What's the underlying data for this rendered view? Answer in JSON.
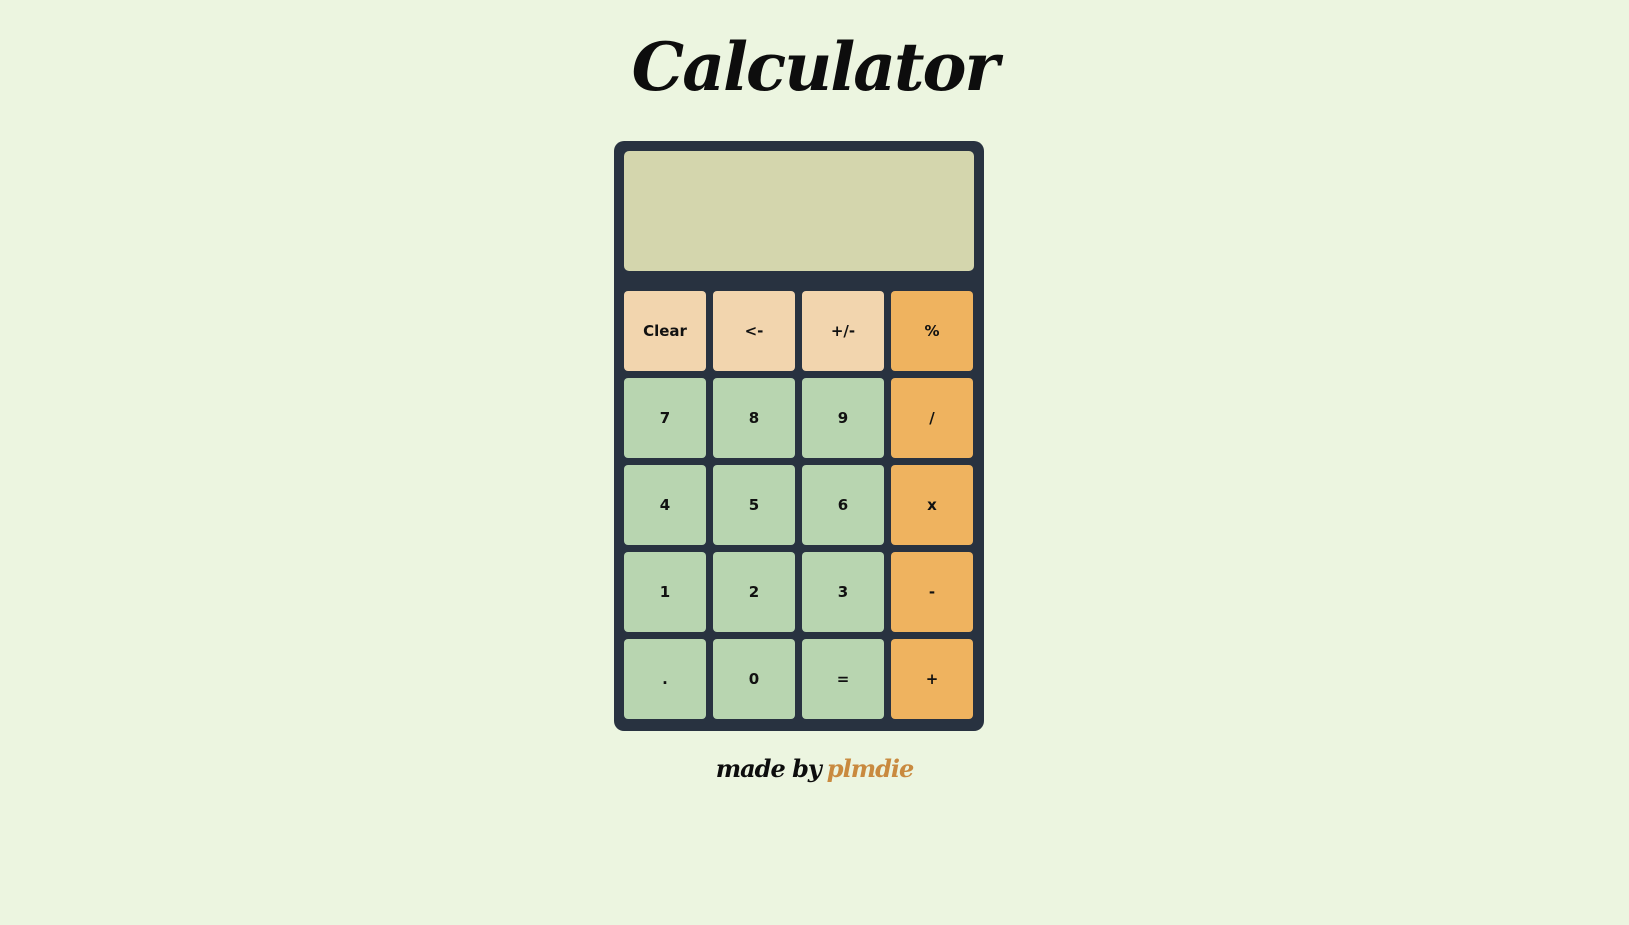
{
  "title": "Calculator",
  "display": {
    "value": ""
  },
  "keys": [
    {
      "label": "Clear",
      "kind": "func",
      "name": "clear-button"
    },
    {
      "label": "<-",
      "kind": "func",
      "name": "backspace-button"
    },
    {
      "label": "+/-",
      "kind": "func",
      "name": "sign-toggle-button"
    },
    {
      "label": "%",
      "kind": "op",
      "name": "percent-button"
    },
    {
      "label": "7",
      "kind": "num",
      "name": "digit-7-button"
    },
    {
      "label": "8",
      "kind": "num",
      "name": "digit-8-button"
    },
    {
      "label": "9",
      "kind": "num",
      "name": "digit-9-button"
    },
    {
      "label": "/",
      "kind": "op",
      "name": "divide-button"
    },
    {
      "label": "4",
      "kind": "num",
      "name": "digit-4-button"
    },
    {
      "label": "5",
      "kind": "num",
      "name": "digit-5-button"
    },
    {
      "label": "6",
      "kind": "num",
      "name": "digit-6-button"
    },
    {
      "label": "x",
      "kind": "op",
      "name": "multiply-button"
    },
    {
      "label": "1",
      "kind": "num",
      "name": "digit-1-button"
    },
    {
      "label": "2",
      "kind": "num",
      "name": "digit-2-button"
    },
    {
      "label": "3",
      "kind": "num",
      "name": "digit-3-button"
    },
    {
      "label": "-",
      "kind": "op",
      "name": "subtract-button"
    },
    {
      "label": ".",
      "kind": "num",
      "name": "decimal-button"
    },
    {
      "label": "0",
      "kind": "num",
      "name": "digit-0-button"
    },
    {
      "label": "=",
      "kind": "num",
      "name": "equals-button"
    },
    {
      "label": "+",
      "kind": "op",
      "name": "add-button"
    }
  ],
  "footer": {
    "prefix": "made by",
    "author": "plmdie"
  },
  "colors": {
    "page_background": "#ecf5e0",
    "calculator_body": "#283240",
    "display_background": "#d4d6ad",
    "function_key": "#f2d5ae",
    "number_key": "#b8d5b0",
    "operator_key": "#efb35f",
    "author_link": "#c98a3f"
  }
}
